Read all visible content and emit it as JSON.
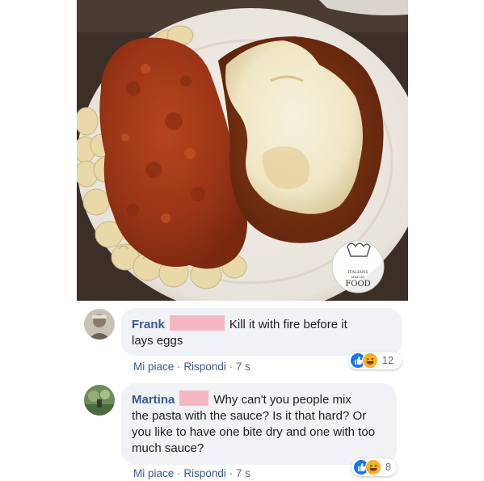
{
  "photo": {
    "name": "food-photo",
    "watermark": {
      "line1": "ITALIANS",
      "line2": "MAD AT",
      "line3": "FOOD"
    }
  },
  "comments": [
    {
      "author": "Frank",
      "text_line1": "Kill it with fire before it",
      "text_rest": "lays eggs",
      "like_label": "Mi piace",
      "reply_label": "Rispondi",
      "separator": "·",
      "time": "7 s",
      "reaction_count": "12",
      "reaction_icons": [
        "like-icon",
        "haha-icon"
      ]
    },
    {
      "author": "Martina",
      "text_line1": "Why can't you people mix",
      "text_rest": "the pasta with the sauce? Is it that hard? Or you like to have one bite dry and one with too much sauce?",
      "like_label": "Mi piace",
      "reply_label": "Rispondi",
      "separator": "·",
      "time": "7 s",
      "reaction_count": "8",
      "reaction_icons": [
        "like-icon",
        "haha-icon"
      ]
    }
  ],
  "colors": {
    "author": "#385898",
    "bubble": "#f0f2f5",
    "redaction": "#f5b8c2",
    "like": "#1877f2",
    "haha": "#f7b125"
  }
}
